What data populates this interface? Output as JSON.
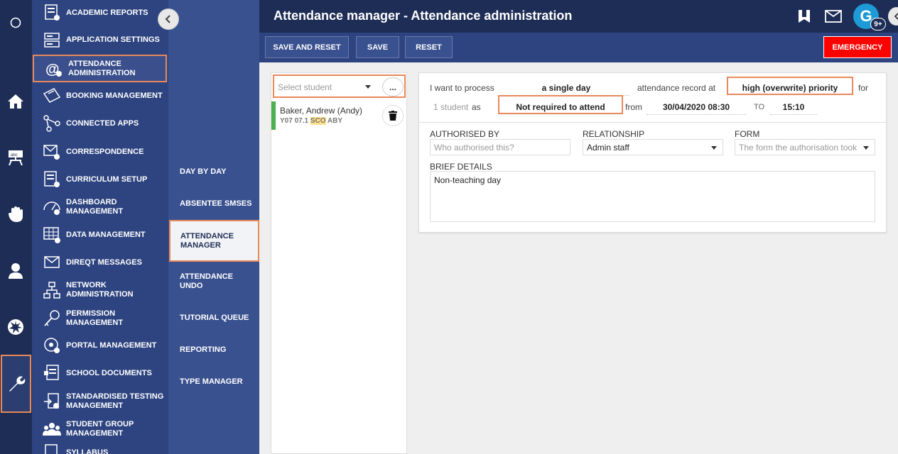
{
  "menu": {
    "items": [
      {
        "label": "ACADEMIC REPORTS",
        "icon": "report-icon"
      },
      {
        "label": "APPLICATION SETTINGS",
        "icon": "settings-icon"
      },
      {
        "label": "ATTENDANCE ADMINISTRATION",
        "icon": "attendance-icon"
      },
      {
        "label": "BOOKING MANAGEMENT",
        "icon": "ticket-icon"
      },
      {
        "label": "CONNECTED APPS",
        "icon": "connected-icon"
      },
      {
        "label": "CORRESPONDENCE",
        "icon": "mail-icon"
      },
      {
        "label": "CURRICULUM SETUP",
        "icon": "curriculum-icon"
      },
      {
        "label": "DASHBOARD MANAGEMENT",
        "icon": "dashboard-icon"
      },
      {
        "label": "DATA MANAGEMENT",
        "icon": "table-icon"
      },
      {
        "label": "DIREQT MESSAGES",
        "icon": "message-icon"
      },
      {
        "label": "NETWORK ADMINISTRATION",
        "icon": "network-icon"
      },
      {
        "label": "PERMISSION MANAGEMENT",
        "icon": "key-icon"
      },
      {
        "label": "PORTAL MANAGEMENT",
        "icon": "portal-icon"
      },
      {
        "label": "SCHOOL DOCUMENTS",
        "icon": "documents-icon"
      },
      {
        "label": "STANDARDISED TESTING MANAGEMENT",
        "icon": "testing-icon"
      },
      {
        "label": "STUDENT GROUP MANAGEMENT",
        "icon": "group-icon"
      },
      {
        "label": "SYLLABUS",
        "icon": "syllabus-icon"
      }
    ]
  },
  "submenu": {
    "items": [
      "DAY BY DAY",
      "ABSENTEE SMSES",
      "ATTENDANCE MANAGER",
      "ATTENDANCE UNDO",
      "TUTORIAL QUEUE",
      "REPORTING",
      "TYPE MANAGER"
    ]
  },
  "header": {
    "title": "Attendance manager - Attendance administration",
    "avatar_letter": "G",
    "notification_count": "9+"
  },
  "toolbar": {
    "save_reset": "SAVE AND RESET",
    "save": "SAVE",
    "reset": "RESET",
    "emergency": "EMERGENCY"
  },
  "student_panel": {
    "placeholder": "Select student",
    "more": "...",
    "student": {
      "name": "Baker, Andrew (Andy)",
      "meta_a": "Y07 07.1",
      "meta_hl": "SCO",
      "meta_b": "ABY"
    }
  },
  "form": {
    "t1": "I want to process",
    "mode": "a single day",
    "t2": "attendance record at",
    "priority": "high (overwrite) priority",
    "t3": "for",
    "count": "1 student",
    "t4": "as",
    "reason": "Not required to attend",
    "t5": "from",
    "from": "30/04/2020 08:30",
    "t6": "TO",
    "to": "15:10",
    "auth_label": "AUTHORISED BY",
    "auth_placeholder": "Who authorised this?",
    "rel_label": "RELATIONSHIP",
    "rel_value": "Admin staff",
    "form_label": "FORM",
    "form_placeholder": "The form the authorisation took",
    "brief_label": "BRIEF DETAILS",
    "brief_value": "Non-teaching day"
  },
  "colors": {
    "rail": "#1e2d56",
    "menu": "#2e4480",
    "submenu": "#3a5190",
    "highlight": "#e8895a",
    "emergency": "#ff0000",
    "student_bar": "#4caf50"
  }
}
